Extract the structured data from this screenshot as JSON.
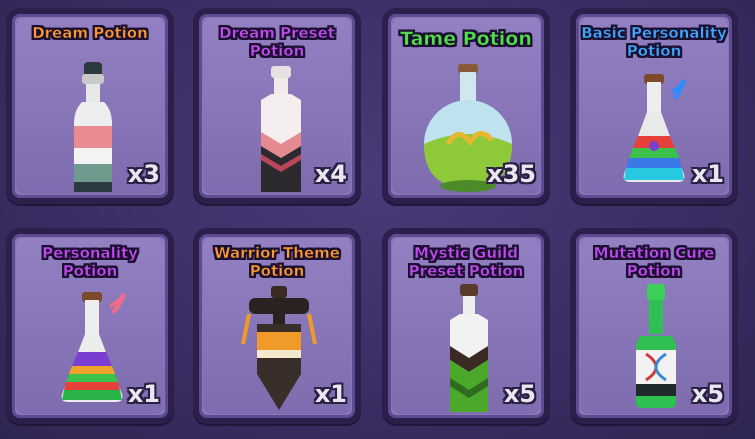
{
  "inventory": {
    "items": [
      {
        "name": "Dream Potion",
        "quantity": "x3",
        "title_color": "#ff9a2e",
        "icon": "dream-potion-icon"
      },
      {
        "name": "Dream Preset Potion",
        "quantity": "x4",
        "title_color": "#c34cf0",
        "icon": "dream-preset-potion-icon"
      },
      {
        "name": "Tame Potion",
        "quantity": "x35",
        "title_color": "#52e04a",
        "icon": "tame-potion-icon"
      },
      {
        "name": "Basic Personality Potion",
        "quantity": "x1",
        "title_color": "#3fa8ff",
        "icon": "basic-personality-potion-icon"
      },
      {
        "name": "Personality Potion",
        "quantity": "x1",
        "title_color": "#c24af0",
        "icon": "personality-potion-icon"
      },
      {
        "name": "Warrior Theme Potion",
        "quantity": "x1",
        "title_color": "#ff9a2e",
        "icon": "warrior-theme-potion-icon"
      },
      {
        "name": "Mystic Guild Preset Potion",
        "quantity": "x5",
        "title_color": "#c24af0",
        "icon": "mystic-guild-preset-potion-icon"
      },
      {
        "name": "Mutation Cure Potion",
        "quantity": "x5",
        "title_color": "#c24af0",
        "icon": "mutation-cure-potion-icon"
      }
    ]
  }
}
